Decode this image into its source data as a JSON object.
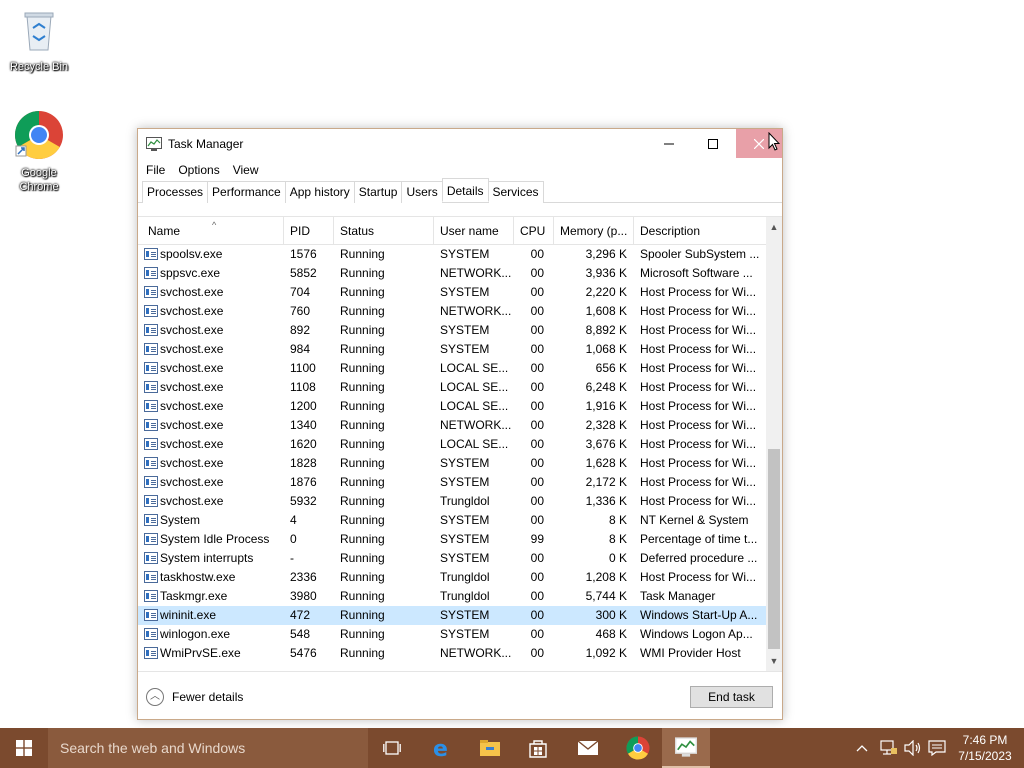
{
  "desktop": {
    "recycle_bin_label": "Recycle Bin",
    "chrome_label": "Google Chrome"
  },
  "window": {
    "title": "Task Manager",
    "menu": [
      "File",
      "Options",
      "View"
    ],
    "tabs": [
      "Processes",
      "Performance",
      "App history",
      "Startup",
      "Users",
      "Details",
      "Services"
    ],
    "active_tab": "Details"
  },
  "table": {
    "columns": [
      "Name",
      "PID",
      "Status",
      "User name",
      "CPU",
      "Memory (p...",
      "Description"
    ],
    "rows": [
      {
        "name": "spoolsv.exe",
        "pid": "1576",
        "status": "Running",
        "user": "SYSTEM",
        "cpu": "00",
        "mem": "3,296 K",
        "desc": "Spooler SubSystem ..."
      },
      {
        "name": "sppsvc.exe",
        "pid": "5852",
        "status": "Running",
        "user": "NETWORK...",
        "cpu": "00",
        "mem": "3,936 K",
        "desc": "Microsoft Software ..."
      },
      {
        "name": "svchost.exe",
        "pid": "704",
        "status": "Running",
        "user": "SYSTEM",
        "cpu": "00",
        "mem": "2,220 K",
        "desc": "Host Process for Wi..."
      },
      {
        "name": "svchost.exe",
        "pid": "760",
        "status": "Running",
        "user": "NETWORK...",
        "cpu": "00",
        "mem": "1,608 K",
        "desc": "Host Process for Wi..."
      },
      {
        "name": "svchost.exe",
        "pid": "892",
        "status": "Running",
        "user": "SYSTEM",
        "cpu": "00",
        "mem": "8,892 K",
        "desc": "Host Process for Wi..."
      },
      {
        "name": "svchost.exe",
        "pid": "984",
        "status": "Running",
        "user": "SYSTEM",
        "cpu": "00",
        "mem": "1,068 K",
        "desc": "Host Process for Wi..."
      },
      {
        "name": "svchost.exe",
        "pid": "1100",
        "status": "Running",
        "user": "LOCAL SE...",
        "cpu": "00",
        "mem": "656 K",
        "desc": "Host Process for Wi..."
      },
      {
        "name": "svchost.exe",
        "pid": "1108",
        "status": "Running",
        "user": "LOCAL SE...",
        "cpu": "00",
        "mem": "6,248 K",
        "desc": "Host Process for Wi..."
      },
      {
        "name": "svchost.exe",
        "pid": "1200",
        "status": "Running",
        "user": "LOCAL SE...",
        "cpu": "00",
        "mem": "1,916 K",
        "desc": "Host Process for Wi..."
      },
      {
        "name": "svchost.exe",
        "pid": "1340",
        "status": "Running",
        "user": "NETWORK...",
        "cpu": "00",
        "mem": "2,328 K",
        "desc": "Host Process for Wi..."
      },
      {
        "name": "svchost.exe",
        "pid": "1620",
        "status": "Running",
        "user": "LOCAL SE...",
        "cpu": "00",
        "mem": "3,676 K",
        "desc": "Host Process for Wi..."
      },
      {
        "name": "svchost.exe",
        "pid": "1828",
        "status": "Running",
        "user": "SYSTEM",
        "cpu": "00",
        "mem": "1,628 K",
        "desc": "Host Process for Wi..."
      },
      {
        "name": "svchost.exe",
        "pid": "1876",
        "status": "Running",
        "user": "SYSTEM",
        "cpu": "00",
        "mem": "2,172 K",
        "desc": "Host Process for Wi..."
      },
      {
        "name": "svchost.exe",
        "pid": "5932",
        "status": "Running",
        "user": "Trungldol",
        "cpu": "00",
        "mem": "1,336 K",
        "desc": "Host Process for Wi..."
      },
      {
        "name": "System",
        "pid": "4",
        "status": "Running",
        "user": "SYSTEM",
        "cpu": "00",
        "mem": "8 K",
        "desc": "NT Kernel & System"
      },
      {
        "name": "System Idle Process",
        "pid": "0",
        "status": "Running",
        "user": "SYSTEM",
        "cpu": "99",
        "mem": "8 K",
        "desc": "Percentage of time t..."
      },
      {
        "name": "System interrupts",
        "pid": "-",
        "status": "Running",
        "user": "SYSTEM",
        "cpu": "00",
        "mem": "0 K",
        "desc": "Deferred procedure ..."
      },
      {
        "name": "taskhostw.exe",
        "pid": "2336",
        "status": "Running",
        "user": "Trungldol",
        "cpu": "00",
        "mem": "1,208 K",
        "desc": "Host Process for Wi..."
      },
      {
        "name": "Taskmgr.exe",
        "pid": "3980",
        "status": "Running",
        "user": "Trungldol",
        "cpu": "00",
        "mem": "5,744 K",
        "desc": "Task Manager"
      },
      {
        "name": "wininit.exe",
        "pid": "472",
        "status": "Running",
        "user": "SYSTEM",
        "cpu": "00",
        "mem": "300 K",
        "desc": "Windows Start-Up A..."
      },
      {
        "name": "winlogon.exe",
        "pid": "548",
        "status": "Running",
        "user": "SYSTEM",
        "cpu": "00",
        "mem": "468 K",
        "desc": "Windows Logon Ap..."
      },
      {
        "name": "WmiPrvSE.exe",
        "pid": "5476",
        "status": "Running",
        "user": "NETWORK...",
        "cpu": "00",
        "mem": "1,092 K",
        "desc": "WMI Provider Host"
      }
    ],
    "selected_name": "wininit.exe"
  },
  "footer": {
    "fewer_details": "Fewer details",
    "end_task": "End task"
  },
  "taskbar": {
    "search_placeholder": "Search the web and Windows",
    "time": "7:46 PM",
    "date": "7/15/2023"
  },
  "colors": {
    "taskbar": "#7b4a2e",
    "selected_row": "#cce8ff",
    "close_button": "#e8a0a8"
  }
}
